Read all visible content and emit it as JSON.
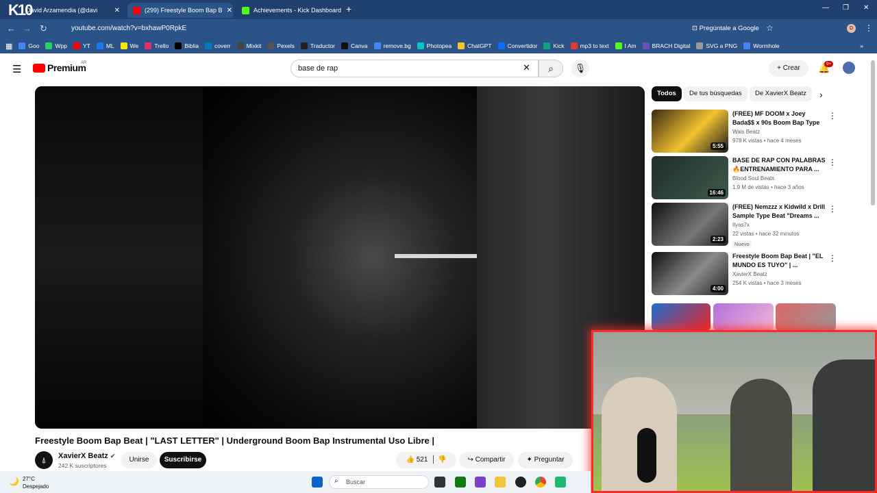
{
  "browser": {
    "tabs": [
      {
        "label": "David Arzamendia (@davi",
        "active": false
      },
      {
        "label": "(299) Freestyle Boom Bap B",
        "active": true
      },
      {
        "label": "Achievements - Kick Dashboard",
        "active": false
      }
    ],
    "url": "youtube.com/watch?v=bxhawP0RpkE",
    "google_btn": "Pregúntale a Google",
    "bookmarks": [
      "Goo",
      "Wpp",
      "YT",
      "ML",
      "We",
      "Trello",
      "Biblia",
      "coverr",
      "Mixkit",
      "Pexels",
      "Traductor",
      "Canva",
      "remove.bg",
      "Photopea",
      "ChatGPT",
      "Convertidor",
      "Kick",
      "mp3 to text",
      "I Am",
      "BRACH Digital",
      "SVG a PNG",
      "Wormhole"
    ],
    "overlay_logo": "K10"
  },
  "youtube": {
    "logo": "Premium",
    "region": "AR",
    "search_value": "base de rap",
    "create_label": "Crear",
    "notif_count": "9+"
  },
  "video": {
    "title": "Freestyle Boom Bap Beat | \"LAST LETTER\" | Underground Boom Bap Instrumental Uso Libre |",
    "channel": "XavierX Beatz",
    "subscribers": "242 K suscriptores",
    "join_label": "Unirse",
    "subscribe_label": "Suscribirse",
    "likes": "521",
    "share_label": "Compartir",
    "ask_label": "Preguntar"
  },
  "chips": [
    "Todos",
    "De tus búsquedas",
    "De XavierX Beatz"
  ],
  "recommendations": [
    {
      "title": "(FREE) MF DOOM x Joey Bada$$ x 90s Boom Bap Type ...",
      "channel": "Wais Beatz",
      "meta": "978 K vistas • hace 4 meses",
      "duration": "5:55",
      "badge": ""
    },
    {
      "title": "BASE DE RAP CON PALABRAS 🔥ENTRENAMIENTO PARA ...",
      "channel": "Blood Soul Beats",
      "meta": "1.9 M de vistas • hace 3 años",
      "duration": "16:46",
      "badge": ""
    },
    {
      "title": "(FREE) Nemzzz x Kidwild x Drill Sample Type Beat \"Dreams ...",
      "channel": "Ilyas7x",
      "meta": "22 vistas • hace 32 minutos",
      "duration": "2:23",
      "badge": "Nuevo"
    },
    {
      "title": "Freestyle Boom Bap Beat | \"EL MUNDO ES TUYO\" | ...",
      "channel": "XavierX Beatz",
      "meta": "254 K vistas • hace 3 meses",
      "duration": "4:00",
      "badge": ""
    }
  ],
  "taskbar": {
    "temp": "27°C",
    "weather": "Despejado",
    "search_placeholder": "Buscar"
  }
}
